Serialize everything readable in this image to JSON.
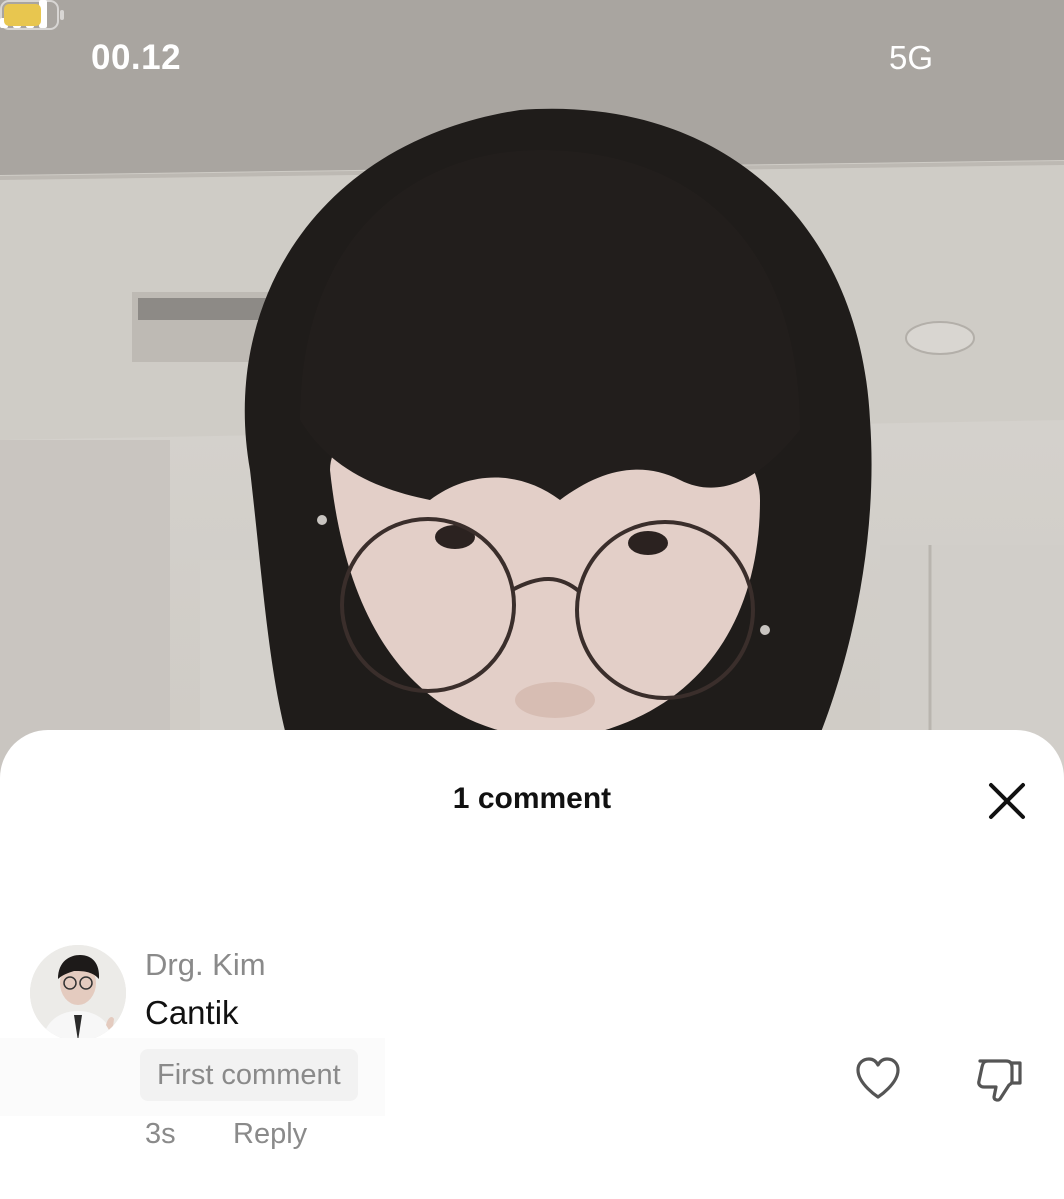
{
  "status_bar": {
    "time": "00.12",
    "network": "5G",
    "icons": [
      "signal-bars-icon",
      "battery-icon"
    ],
    "battery_color": "#e8c64f"
  },
  "sheet": {
    "title": "1 comment",
    "close_icon": "close-icon"
  },
  "comments": [
    {
      "author": "Drg. Kim",
      "text": "Cantik",
      "badge": "First comment",
      "time": "3s",
      "reply_label": "Reply",
      "icons": [
        "heart-outline-icon",
        "dislike-icon"
      ]
    }
  ],
  "colors": {
    "muted_text": "#8a8a8a",
    "primary_text": "#111111",
    "badge_background": "#f2f2f2"
  }
}
